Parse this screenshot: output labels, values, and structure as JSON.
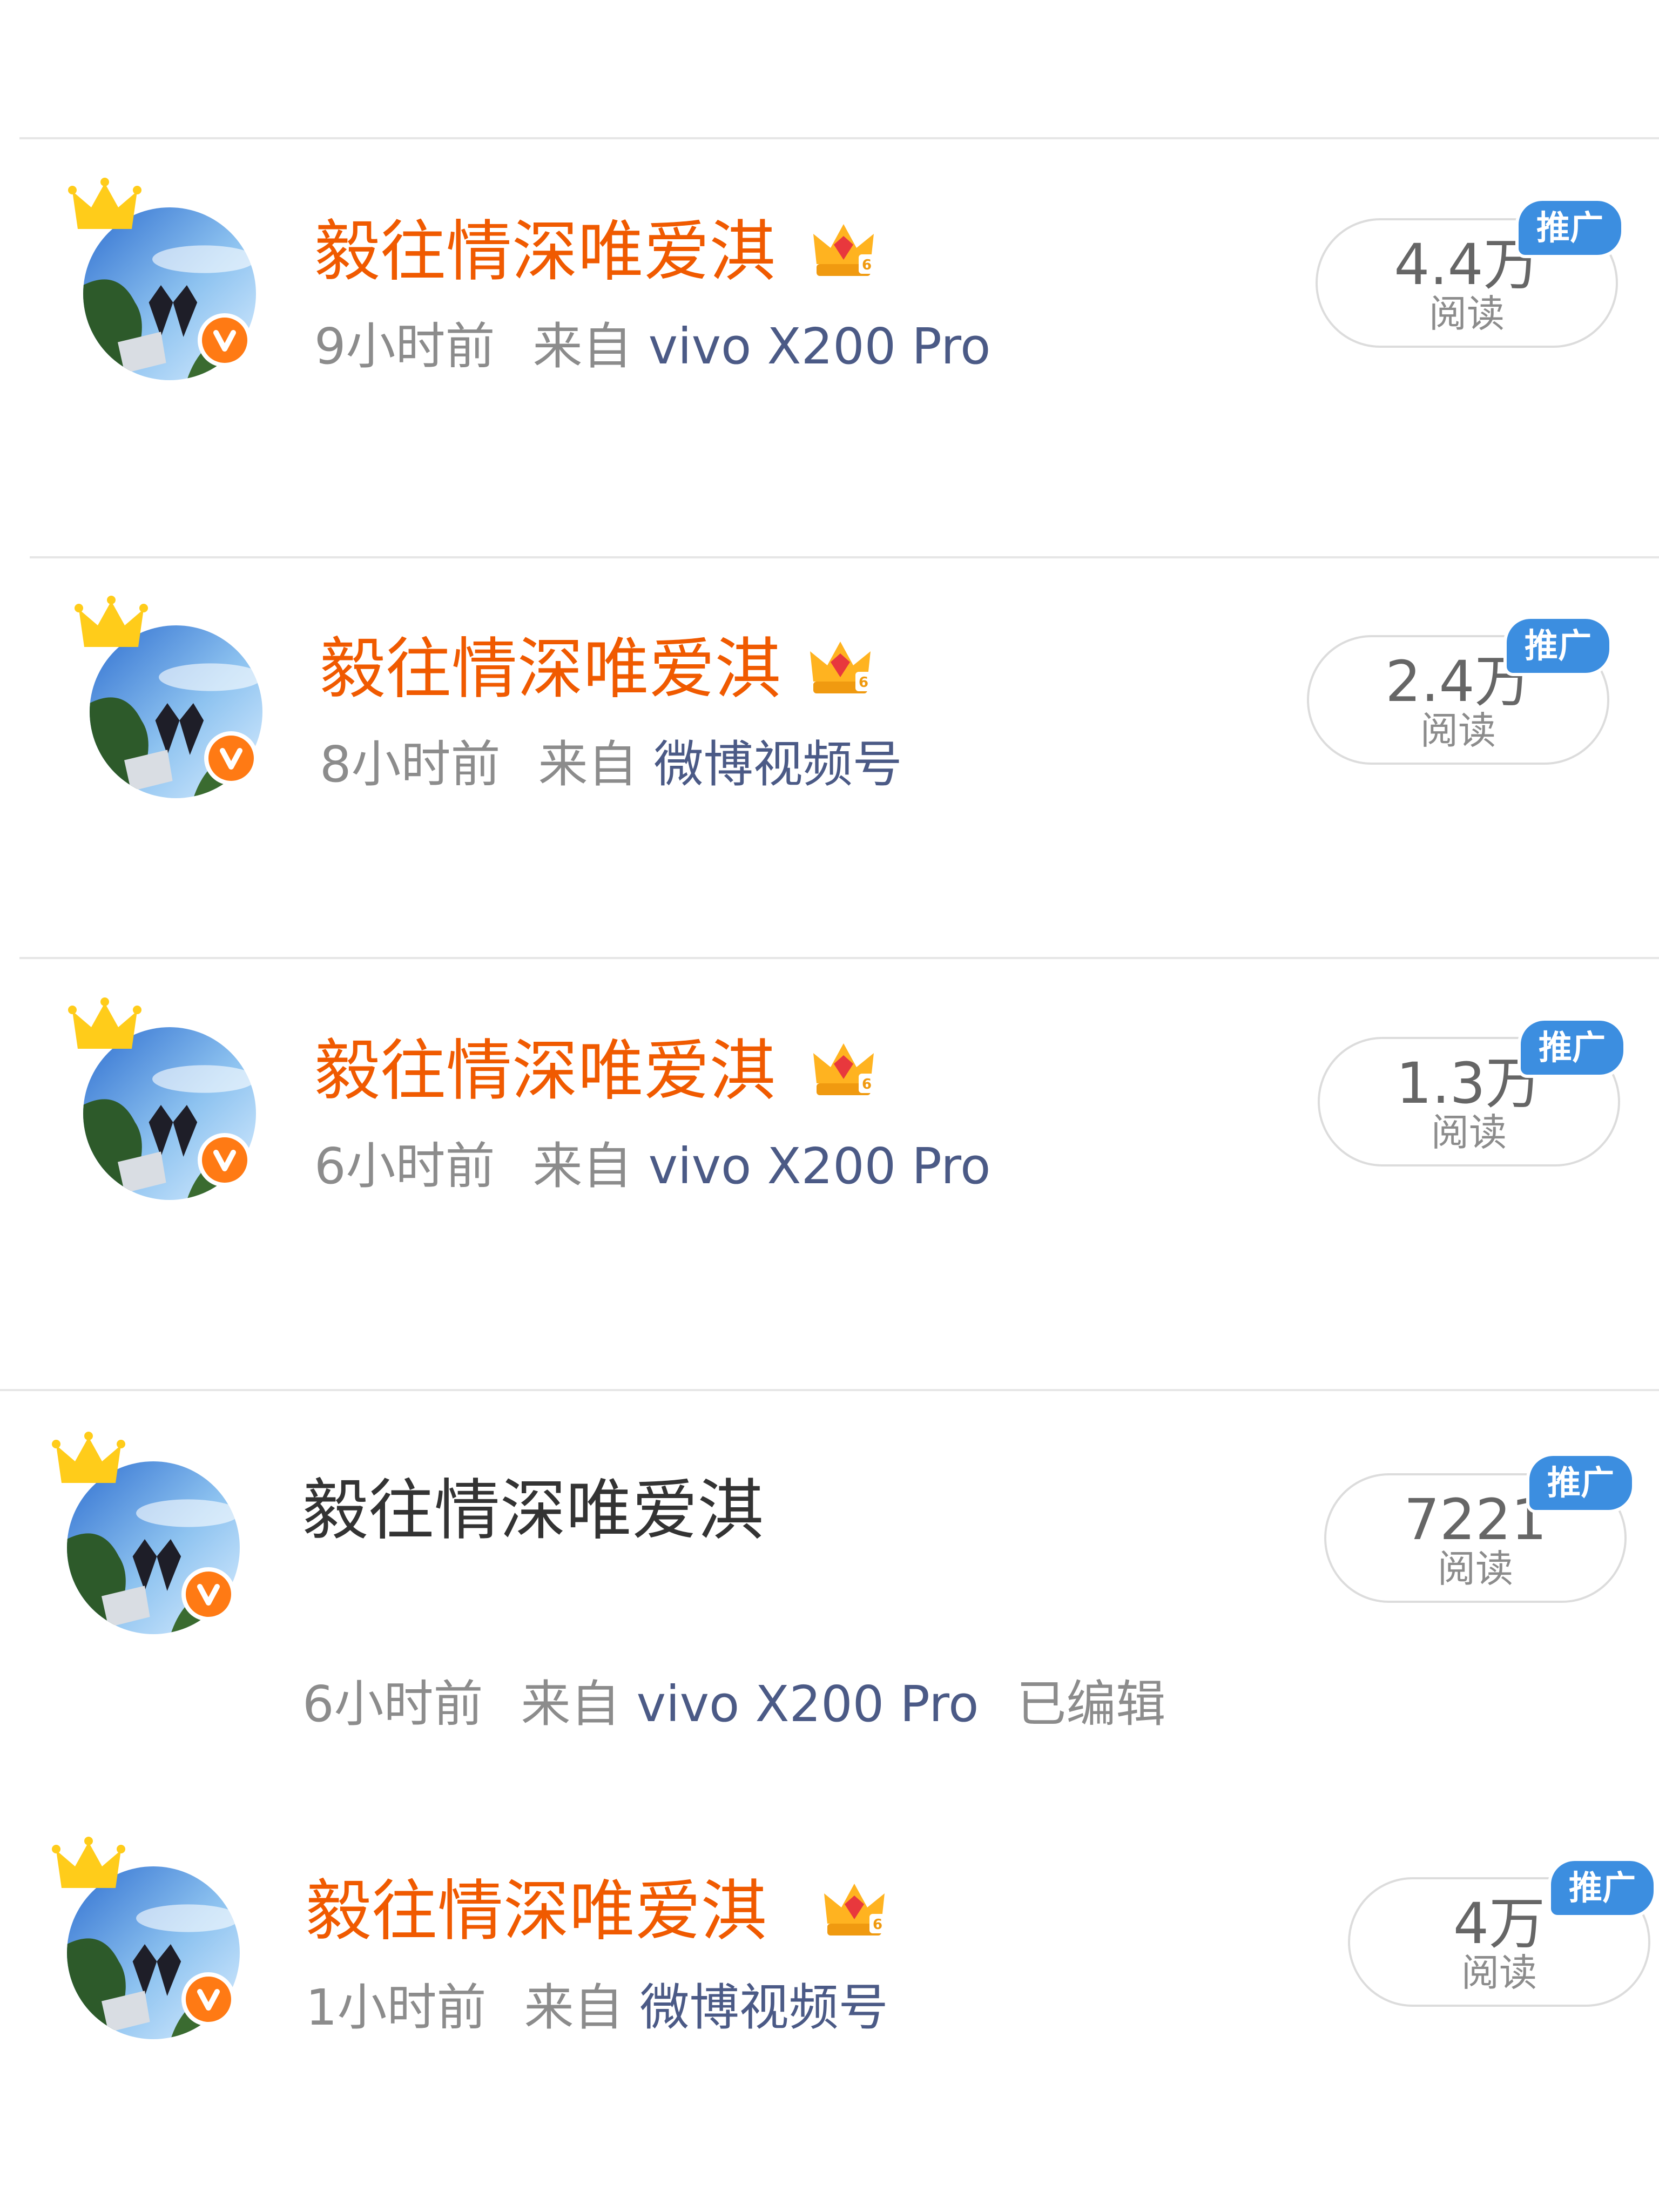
{
  "posts": [
    {
      "username": "毅往情深唯爱淇",
      "time": "9小时前",
      "source_prefix": "来自",
      "source": "vivo X200 Pro",
      "reads_count": "4.4万",
      "reads_label": "阅读",
      "promo": "推广"
    },
    {
      "username": "毅往情深唯爱淇",
      "time": "8小时前",
      "source_prefix": "来自",
      "source": "微博视频号",
      "reads_count": "2.4万",
      "reads_label": "阅读",
      "promo": "推广"
    },
    {
      "username": "毅往情深唯爱淇",
      "time": "6小时前",
      "source_prefix": "来自",
      "source": "vivo X200 Pro",
      "reads_count": "1.3万",
      "reads_label": "阅读",
      "promo": "推广"
    },
    {
      "username": "毅往情深唯爱淇",
      "time": "6小时前",
      "source_prefix": "来自",
      "source": "vivo X200 Pro",
      "edited": "已编辑",
      "reads_count": "7221",
      "reads_label": "阅读",
      "promo": "推广"
    },
    {
      "username": "毅往情深唯爱淇",
      "time": "1小时前",
      "source_prefix": "来自",
      "source": "微博视频号",
      "reads_count": "4万",
      "reads_label": "阅读",
      "promo": "推广"
    }
  ],
  "colors": {
    "username_vip": "#f05a00",
    "source_link": "#4b5a86",
    "meta_gray": "#8c8c8c",
    "verified_badge": "#ff7a14",
    "promo_badge": "#3c8ee0"
  },
  "icons": {
    "avatar_crown": "crown-icon",
    "verified": "verified-v-icon",
    "vip": "vip-crown-level-6-icon"
  }
}
